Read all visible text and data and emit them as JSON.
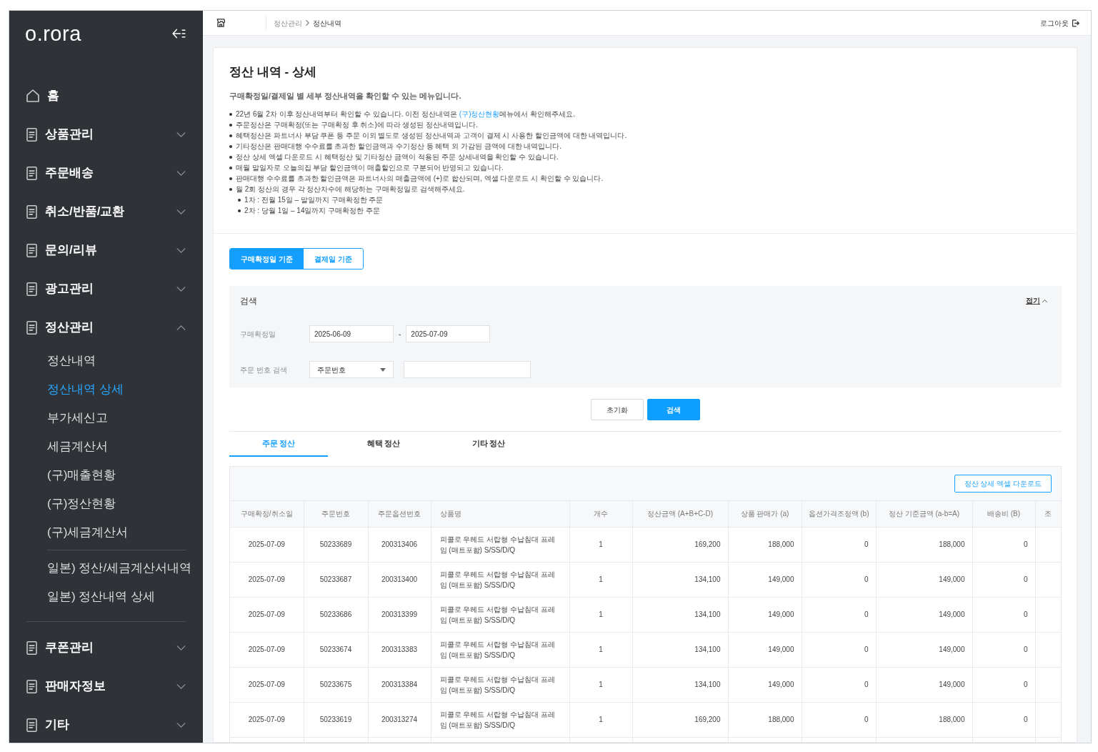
{
  "sidebar": {
    "logo": "o.rora",
    "menu": [
      {
        "kind": "home",
        "label": "홈"
      },
      {
        "kind": "menu",
        "label": "상품관리",
        "expanded": false
      },
      {
        "kind": "menu",
        "label": "주문배송",
        "expanded": false
      },
      {
        "kind": "menu",
        "label": "취소/반품/교환",
        "expanded": false
      },
      {
        "kind": "menu",
        "label": "문의/리뷰",
        "expanded": false
      },
      {
        "kind": "menu",
        "label": "광고관리",
        "expanded": false
      },
      {
        "kind": "menu",
        "label": "정산관리",
        "expanded": true,
        "children": [
          {
            "label": "정산내역",
            "selected": false,
            "divider_before": false
          },
          {
            "label": "정산내역 상세",
            "selected": true,
            "divider_before": false
          },
          {
            "label": "부가세신고",
            "selected": false,
            "divider_before": false
          },
          {
            "label": "세금계산서",
            "selected": false,
            "divider_before": false
          },
          {
            "label": "(구)매출현황",
            "selected": false,
            "divider_before": false
          },
          {
            "label": "(구)정산현황",
            "selected": false,
            "divider_before": false
          },
          {
            "label": "(구)세금계산서",
            "selected": false,
            "divider_before": false
          },
          {
            "label": "일본) 정산/세금계산서내역",
            "selected": false,
            "divider_before": true
          },
          {
            "label": "일본) 정산내역 상세",
            "selected": false,
            "divider_before": false
          }
        ]
      },
      {
        "kind": "menu",
        "label": "쿠폰관리",
        "expanded": false
      },
      {
        "kind": "menu",
        "label": "판매자정보",
        "expanded": false
      },
      {
        "kind": "menu",
        "label": "기타",
        "expanded": false
      }
    ]
  },
  "top_bar": {
    "breadcrumb": [
      "정산관리",
      "정산내역"
    ],
    "logout": "로그아웃"
  },
  "page": {
    "title": "정산 내역 - 상세",
    "subtitle": "구매확정일/결제일 별 세부 정산내역을 확인할 수 있는 메뉴입니다.",
    "notes": [
      {
        "text": "22년 6월 2차 이후 정산내역부터 확인할 수 있습니다. 이전 정산내역은 ",
        "link": "(구)정산현황",
        "text_after": "메뉴에서 확인해주세요."
      },
      {
        "text": "주문정산은 구매확정(또는 구매확정 후 취소)에 따라 생성된 정산내역입니다."
      },
      {
        "text": "혜택정산은 파트너사 부담 쿠폰 등 주문 이외 별도로 생성된 정산내역과 고객이 결제 시 사용한 할인금액에 대한 내역입니다."
      },
      {
        "text": "기타정산은 판매대행 수수료를 초과한 할인금액과 수기정산 등 혜택 외 가감된 금액에 대한 내역입니다."
      },
      {
        "text": "정산 상세 엑셀 다운로드 시 혜택정산 및 기타정산 금액이 적용된 주문 상세내역을 확인할 수 있습니다."
      },
      {
        "text": "매월 말일자로 오늘의집 부담 할인금액이 매출할인으로 구분되어 반영되고 있습니다."
      },
      {
        "text": "판매대행 수수료를 초과한 할인금액은 파트너사의 매출금액에 (+)로 합산되며, 엑셀 다운로드 시 확인할 수 있습니다."
      },
      {
        "text": "월 2회 정산의 경우 각 정산차수에 해당하는 구매확정일로 검색해주세요.",
        "children": [
          {
            "text": "1차 : 전월 15일 – 말일까지 구매확정한 주문"
          },
          {
            "text": "2차 : 당월 1일 – 14일까지 구매확정한 주문"
          }
        ]
      }
    ]
  },
  "search_basis": [
    {
      "label": "구매확정일 기준",
      "selected": true
    },
    {
      "label": "결제일 기준",
      "selected": false
    }
  ],
  "search": {
    "title": "검색",
    "fold": "접기",
    "fields": [
      {
        "kind": "date_range",
        "label": "구매확정일",
        "from": "2025-06-09",
        "separator": "-",
        "to": "2025-07-09"
      },
      {
        "kind": "select_text",
        "label": "주문 번호 검색",
        "select": "주문번호"
      }
    ],
    "buttons": [
      {
        "kind": "secondary",
        "label": "초기화"
      },
      {
        "kind": "primary",
        "label": "검색"
      }
    ]
  },
  "tabs": [
    {
      "label": "주문 정산",
      "selected": true
    },
    {
      "label": "혜택 정산",
      "selected": false
    },
    {
      "label": "기타 정산",
      "selected": false
    }
  ],
  "table": {
    "download_button": "정산 상세 엑셀 다운로드",
    "columns": [
      {
        "label": "구매확정/취소일",
        "kind": "center"
      },
      {
        "label": "주문번호",
        "kind": "center"
      },
      {
        "label": "주문옵션번호",
        "kind": "center"
      },
      {
        "label": "상품명",
        "kind": "text"
      },
      {
        "label": "개수",
        "kind": "center"
      },
      {
        "label": "정산금액 (A+B+C-D)",
        "kind": "amount"
      },
      {
        "label": "상품 판매가 (a)",
        "kind": "amount"
      },
      {
        "label": "옵션가격조정액 (b)",
        "kind": "amount"
      },
      {
        "label": "정산 기준금액 (a-b=A)",
        "kind": "amount"
      },
      {
        "label": "배송비 (B)",
        "kind": "amount"
      },
      {
        "label": "조",
        "kind": "amount"
      }
    ],
    "rows": [
      [
        "2025-07-09",
        "50233689",
        "200313406",
        "피콜로 우헤드 서랍형 수납침대 프레임 (매트포함) S/SS/D/Q",
        "1",
        "169,200",
        "188,000",
        "0",
        "188,000",
        "0"
      ],
      [
        "2025-07-09",
        "50233687",
        "200313400",
        "피콜로 우헤드 서랍형 수납침대 프레임 (매트포함) S/SS/D/Q",
        "1",
        "134,100",
        "149,000",
        "0",
        "149,000",
        "0"
      ],
      [
        "2025-07-09",
        "50233686",
        "200313399",
        "피콜로 우헤드 서랍형 수납침대 프레임 (매트포함) S/SS/D/Q",
        "1",
        "134,100",
        "149,000",
        "0",
        "149,000",
        "0"
      ],
      [
        "2025-07-09",
        "50233674",
        "200313383",
        "피콜로 우헤드 서랍형 수납침대 프레임 (매트포함) S/SS/D/Q",
        "1",
        "134,100",
        "149,000",
        "0",
        "149,000",
        "0"
      ],
      [
        "2025-07-09",
        "50233675",
        "200313384",
        "피콜로 우헤드 서랍형 수납침대 프레임 (매트포함) S/SS/D/Q",
        "1",
        "134,100",
        "149,000",
        "0",
        "149,000",
        "0"
      ],
      [
        "2025-07-09",
        "50233619",
        "200313274",
        "피콜로 우헤드 서랍형 수납침대 프레임 (매트포함) S/SS/D/Q",
        "1",
        "169,200",
        "188,000",
        "0",
        "188,000",
        "0"
      ]
    ]
  }
}
